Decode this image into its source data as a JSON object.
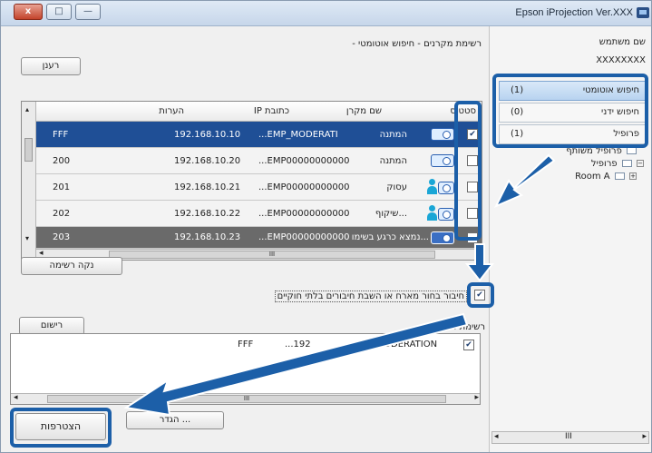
{
  "window": {
    "title": "Epson iProjection Ver.XXX",
    "controls": {
      "close": "x",
      "maximize": "□",
      "minimize": "—"
    }
  },
  "user": {
    "label": "שם משתמש",
    "name": "XXXXXXXX"
  },
  "nav": {
    "items": [
      {
        "label": "חיפוש אוטומטי",
        "count": "(1)",
        "selected": true
      },
      {
        "label": "חיפוש ידני",
        "count": "(0)",
        "selected": false
      },
      {
        "label": "פרופיל",
        "count": "(1)",
        "selected": false
      }
    ]
  },
  "tree": {
    "items": [
      {
        "label": "פרופיל משותף"
      },
      {
        "label": "פרופיל"
      },
      {
        "label": "Room A"
      }
    ]
  },
  "projector_list": {
    "heading": "רשימת מקרנים - חיפוש אוטומטי -",
    "refresh_label": "רענן",
    "columns": [
      "סטטוס",
      "שם מקרן",
      "כתובת IP",
      "הערות"
    ],
    "rows": [
      {
        "checked": true,
        "status": "המתנה",
        "name": "...EMP_MODERATI",
        "ip": "192.168.10.10",
        "note": "FFF",
        "icon": "projector-icon",
        "state": "selected"
      },
      {
        "checked": false,
        "status": "המתנה",
        "name": "...EMP00000000000",
        "ip": "192.168.10.20",
        "note": "200",
        "icon": "projector-icon",
        "state": "normal"
      },
      {
        "checked": false,
        "status": "עסוק",
        "name": "...EMP00000000000",
        "ip": "192.168.10.21",
        "note": "201",
        "icon": "user-projector-icon",
        "state": "normal"
      },
      {
        "checked": false,
        "status": "...שיקוף",
        "name": "...EMP00000000000",
        "ip": "192.168.10.22",
        "note": "202",
        "icon": "multi-user-projector-icon",
        "state": "normal"
      },
      {
        "checked": false,
        "status": "...נמצא כרגע בשימו",
        "name": "...EMP00000000000",
        "ip": "192.168.10.23",
        "note": "203",
        "icon": "monitor-projector-icon",
        "state": "dim"
      }
    ],
    "clear_label": "נקה רשימה"
  },
  "options": {
    "interrupt_label": "חיבור בחור מארח או השבת חיבורים בלתי חוקיים",
    "interrupt_checked": true
  },
  "registration": {
    "button_label": "רישום",
    "list_label": "רשימת ...",
    "rows": [
      {
        "checked": true,
        "name": "..._MODERATION",
        "ip": "...192",
        "note": "FFF"
      }
    ]
  },
  "footer": {
    "settings_label": "הגדר ...",
    "join_label": "הצטרפות"
  }
}
